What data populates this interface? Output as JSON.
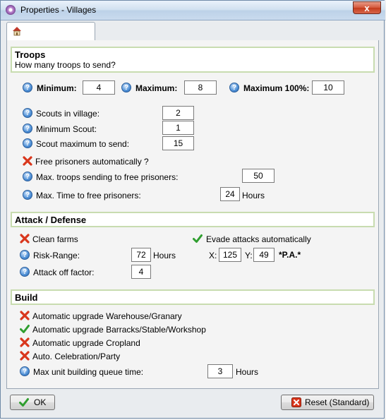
{
  "window": {
    "title": "Properties - Villages",
    "close_symbol": "x"
  },
  "icons": {
    "help": "?",
    "help_icon": "question-circle",
    "negative_icon": "red-x",
    "positive_icon": "green-check",
    "tab_icon": "house-icon"
  },
  "troops": {
    "title": "Troops",
    "subtitle": "How many troops to send?",
    "minimum_label": "Minimum:",
    "minimum_value": "4",
    "maximum_label": "Maximum:",
    "maximum_value": "8",
    "maximum100_label": "Maximum 100%:",
    "maximum100_value": "10",
    "scouts_label": "Scouts in village:",
    "scouts_value": "2",
    "min_scout_label": "Minimum Scout:",
    "min_scout_value": "1",
    "scout_max_label": "Scout maximum to send:",
    "scout_max_value": "15",
    "free_prisoners_label": "Free prisoners automatically ?",
    "free_prisoners_enabled": false,
    "max_troops_prisoners_label": "Max. troops sending to free prisoners:",
    "max_troops_prisoners_value": "50",
    "max_time_prisoners_label": "Max. Time to free prisoners:",
    "max_time_prisoners_value": "24",
    "hours_unit": "Hours"
  },
  "attack": {
    "title": "Attack / Defense",
    "clean_farms_label": "Clean farms",
    "clean_farms_enabled": false,
    "evade_label": "Evade attacks automatically",
    "evade_enabled": true,
    "risk_range_label": "Risk-Range:",
    "risk_range_value": "72",
    "hours_unit": "Hours",
    "x_label": "X:",
    "x_value": "125",
    "y_label": "Y:",
    "y_value": "49",
    "pa_label": "*P.A.*",
    "attack_off_label": "Attack off factor:",
    "attack_off_value": "4"
  },
  "build": {
    "title": "Build",
    "warehouse_label": "Automatic upgrade Warehouse/Granary",
    "warehouse_enabled": false,
    "barracks_label": "Automatic upgrade Barracks/Stable/Workshop",
    "barracks_enabled": true,
    "cropland_label": "Automatic upgrade Cropland",
    "cropland_enabled": false,
    "celebration_label": "Auto. Celebration/Party",
    "celebration_enabled": false,
    "queue_label": "Max unit building queue time:",
    "queue_value": "3",
    "hours_unit": "Hours"
  },
  "footer": {
    "ok_label": "OK",
    "reset_label": "Reset (Standard)"
  }
}
